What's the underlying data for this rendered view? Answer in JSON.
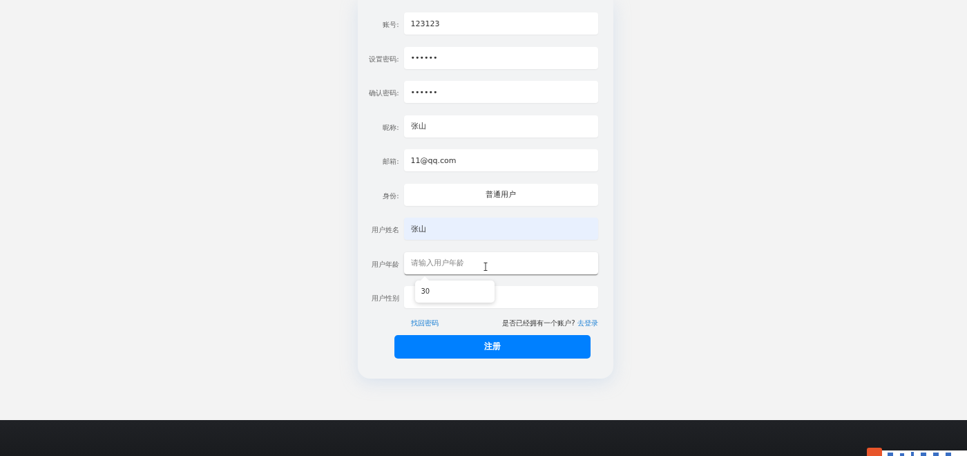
{
  "form": {
    "fields": [
      {
        "label": "账号:",
        "kind": "text",
        "value": "123123",
        "autofilled": false,
        "focused": false
      },
      {
        "label": "设置密码:",
        "kind": "password",
        "value": "••••••",
        "autofilled": false,
        "focused": false
      },
      {
        "label": "确认密码:",
        "kind": "password",
        "value": "••••••",
        "autofilled": false,
        "focused": false
      },
      {
        "label": "昵称:",
        "kind": "text",
        "value": "张山",
        "autofilled": false,
        "focused": false
      },
      {
        "label": "邮箱:",
        "kind": "text",
        "value": "11@qq.com",
        "autofilled": false,
        "focused": false
      },
      {
        "label": "身份:",
        "kind": "select",
        "value": "普通用户",
        "autofilled": false,
        "focused": false
      },
      {
        "label": "用户姓名",
        "kind": "text",
        "value": "张山",
        "autofilled": true,
        "focused": false
      },
      {
        "label": "用户年龄",
        "kind": "text",
        "placeholder": "请输入用户年龄",
        "autofilled": false,
        "focused": true,
        "suggestions": [
          "30"
        ]
      },
      {
        "label": "用户性别",
        "kind": "text",
        "autofilled": false,
        "focused": false
      }
    ],
    "links": {
      "recover": "找回密码",
      "question": "是否已经拥有一个账户?",
      "login": "去登录"
    },
    "submit": "注册"
  }
}
